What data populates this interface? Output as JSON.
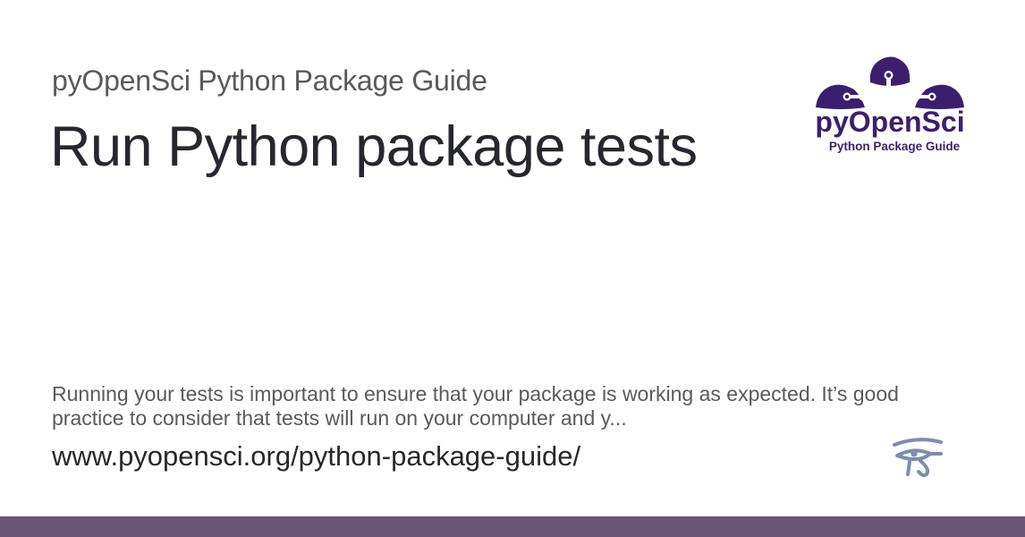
{
  "header": {
    "site_name": "pyOpenSci Python Package Guide",
    "page_title": "Run Python package tests"
  },
  "logo": {
    "brand_text": "pyOpenSci",
    "tagline": "Python Package Guide",
    "icon": "pyopensci-flower-logo"
  },
  "description": "Running your tests is important to ensure that your package is working as expected. It’s good practice to consider that tests will run on your computer and y...",
  "url": "www.pyopensci.org/python-package-guide/",
  "eye_icon": "eye-of-horus-icon",
  "colors": {
    "brand_purple": "#3b1f6e",
    "footer_bar": "#6b5577",
    "eye_icon": "#7c8dad",
    "title_text": "#27272f",
    "muted_text": "#5a5a5a"
  }
}
